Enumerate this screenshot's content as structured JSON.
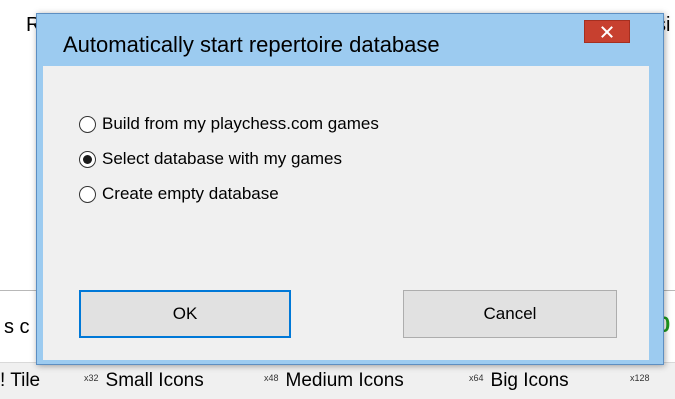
{
  "background": {
    "partial_text_left": "R",
    "partial_text_right": "si",
    "partial_row_left": "s c",
    "partial_row_right": "0",
    "view_options": [
      {
        "badge": "",
        "label": "Tile"
      },
      {
        "badge": "x32",
        "label": "Small Icons"
      },
      {
        "badge": "x48",
        "label": "Medium Icons"
      },
      {
        "badge": "x64",
        "label": "Big Icons"
      },
      {
        "badge": "x128",
        "label": ""
      }
    ],
    "view_prefix": "!"
  },
  "dialog": {
    "title": "Automatically start repertoire database",
    "close_glyph": "×",
    "options": [
      {
        "label": "Build from my playchess.com games",
        "selected": false
      },
      {
        "label": "Select database with my games",
        "selected": true
      },
      {
        "label": "Create empty database",
        "selected": false
      }
    ],
    "ok_label": "OK",
    "cancel_label": "Cancel"
  },
  "colors": {
    "dialog_frame": "#9ccbf0",
    "close_button": "#c7402f",
    "accent_green": "#1e9a1e"
  }
}
